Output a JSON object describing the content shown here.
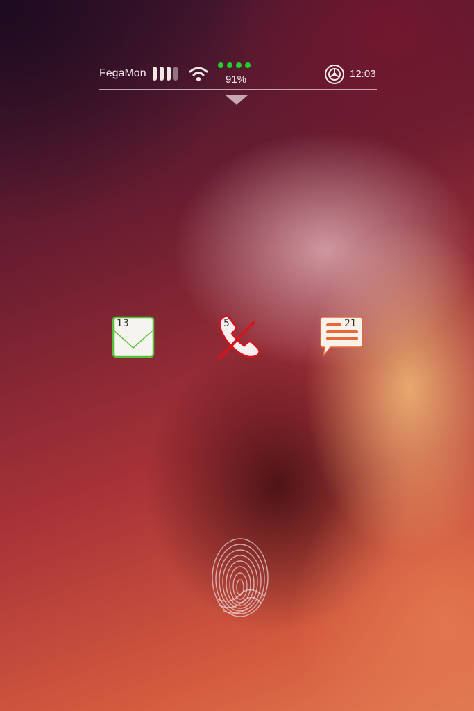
{
  "status_bar": {
    "carrier": "FegaMon",
    "signal_bars": 4,
    "signal_bars_filled": 3,
    "battery_percent": "91%",
    "time": "12:03"
  },
  "notifications": {
    "mail": {
      "icon": "envelope-icon",
      "count": "13",
      "accent": "#53c23a"
    },
    "missed_calls": {
      "icon": "missed-call-icon",
      "count": "5",
      "accent": "#d4141e"
    },
    "messages": {
      "icon": "chat-bubble-icon",
      "count": "21",
      "accent": "#e8673a"
    }
  },
  "unlock": {
    "icon": "fingerprint-icon"
  },
  "colors": {
    "battery_dot": "#1fd12c",
    "status_text": "#f2e8ea"
  }
}
